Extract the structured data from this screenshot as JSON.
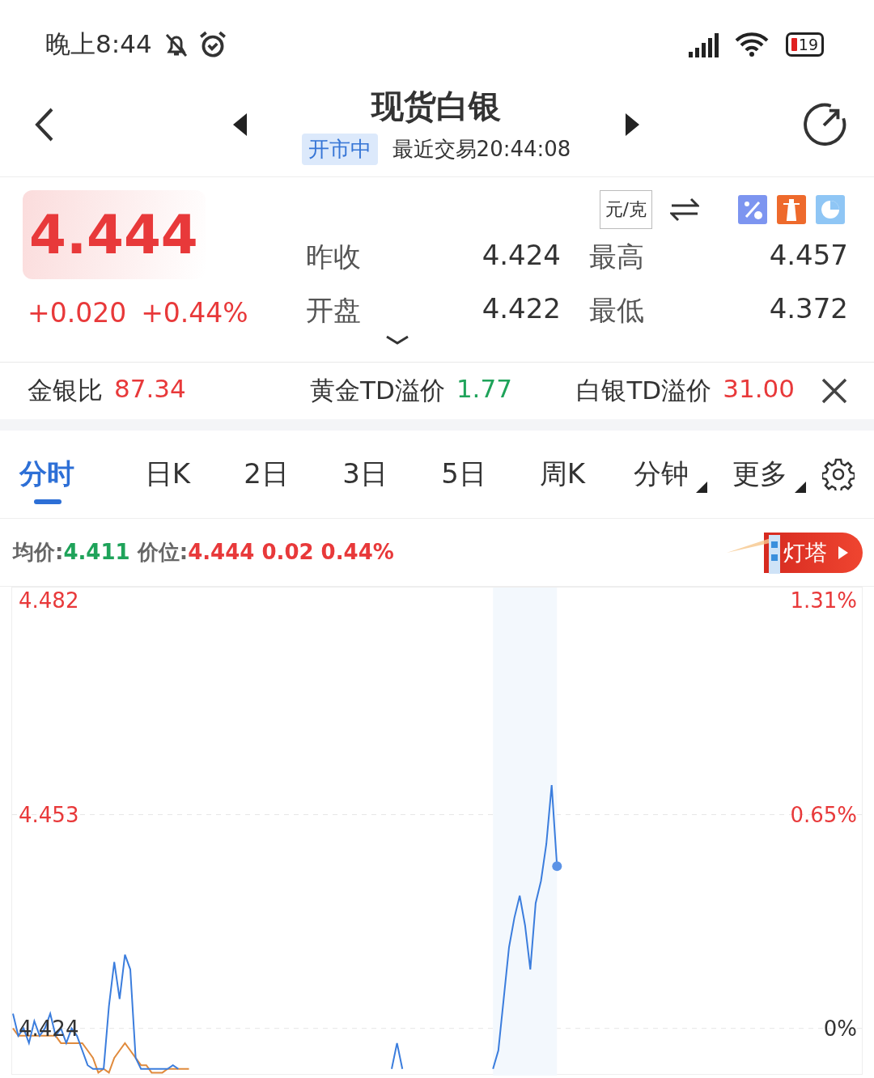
{
  "status_bar": {
    "time": "晚上8:44",
    "battery": "19"
  },
  "header": {
    "title": "现货白银",
    "status_badge": "开市中",
    "last_trade": "最近交易20:44:08"
  },
  "quote": {
    "price": "4.444",
    "change": "+0.020",
    "change_pct": "+0.44%",
    "unit": "元/克",
    "stats": [
      {
        "label": "昨收",
        "value": "4.424"
      },
      {
        "label": "最高",
        "value": "4.457"
      },
      {
        "label": "开盘",
        "value": "4.422"
      },
      {
        "label": "最低",
        "value": "4.372"
      }
    ]
  },
  "ratios": [
    {
      "label": "金银比",
      "value": "87.34",
      "color": "#e8393a"
    },
    {
      "label": "黄金TD溢价",
      "value": "1.77",
      "color": "#1fa35a"
    },
    {
      "label": "白银TD溢价",
      "value": "31.00",
      "color": "#e8393a"
    }
  ],
  "tabs": [
    {
      "label": "分时",
      "selected": true,
      "menu": false
    },
    {
      "label": "日K",
      "selected": false,
      "menu": false
    },
    {
      "label": "2日",
      "selected": false,
      "menu": false
    },
    {
      "label": "3日",
      "selected": false,
      "menu": false
    },
    {
      "label": "5日",
      "selected": false,
      "menu": false
    },
    {
      "label": "周K",
      "selected": false,
      "menu": false
    },
    {
      "label": "分钟",
      "selected": false,
      "menu": true
    },
    {
      "label": "更多",
      "selected": false,
      "menu": true
    }
  ],
  "legend": {
    "avg_label": "均价:",
    "avg": "4.411",
    "price_label": "价位:",
    "price": "4.444",
    "change": "0.02",
    "change_pct": "0.44%",
    "badge": "灯塔"
  },
  "chart": {
    "pct_labels": [
      "1.31%",
      "0.65%",
      "0%"
    ],
    "chart_data": {
      "type": "line",
      "ylim": [
        4.4176,
        4.4838
      ],
      "yticks": [
        4.482,
        4.453,
        4.424
      ],
      "series": [
        {
          "color": "#3b7ddd",
          "values": [
            4.426,
            4.423,
            4.424,
            4.422,
            4.425,
            4.423,
            4.424,
            4.426,
            4.423,
            4.424,
            4.422,
            4.424,
            4.423,
            4.421,
            4.419,
            4.4185,
            4.4185,
            4.4185,
            4.427,
            4.433,
            4.428,
            4.434,
            4.432,
            4.42,
            4.4185,
            4.4185,
            4.4185,
            4.4185,
            4.4185,
            4.4185,
            4.419,
            4.4185,
            null,
            null,
            null,
            null,
            null,
            null,
            null,
            null,
            null,
            null,
            null,
            null,
            null,
            null,
            null,
            null,
            null,
            null,
            null,
            null,
            null,
            null,
            null,
            null,
            null,
            null,
            null,
            null,
            null,
            null,
            null,
            null,
            null,
            null,
            null,
            null,
            null,
            null,
            null,
            4.4185,
            4.422,
            4.4185,
            null,
            null,
            null,
            null,
            null,
            null,
            null,
            null,
            null,
            null,
            null,
            null,
            null,
            null,
            null,
            null,
            4.4185,
            4.421,
            4.428,
            4.435,
            4.439,
            4.442,
            4.438,
            4.432,
            4.441,
            4.444,
            4.449,
            4.457,
            4.446,
            null,
            null,
            null,
            null,
            null,
            null,
            null,
            null,
            null,
            null,
            null,
            null,
            null,
            null,
            null,
            null,
            null,
            null,
            null,
            null,
            null,
            null,
            null,
            null,
            null,
            null,
            null,
            null,
            null,
            null,
            null,
            null,
            null,
            null,
            null,
            null,
            null,
            null,
            null,
            null,
            null,
            null,
            null,
            null,
            null,
            null,
            null,
            null,
            null,
            null,
            null,
            null,
            null,
            null
          ]
        },
        {
          "color": "#e08a3c",
          "values": [
            4.424,
            4.423,
            4.423,
            4.423,
            4.423,
            4.423,
            4.423,
            4.423,
            4.423,
            4.422,
            4.422,
            4.422,
            4.422,
            4.422,
            4.421,
            4.42,
            4.418,
            4.4185,
            4.418,
            4.42,
            4.421,
            4.422,
            4.421,
            4.42,
            4.419,
            4.419,
            4.418,
            4.418,
            4.418,
            4.4185,
            4.4185,
            4.4185,
            4.4185,
            4.4185,
            null,
            null,
            null,
            null,
            null,
            null,
            null,
            null,
            null,
            null,
            null,
            null,
            null,
            null,
            null,
            null,
            null,
            null,
            null,
            null,
            null,
            null,
            null,
            null,
            null,
            null,
            null,
            null,
            null,
            null,
            null,
            null,
            null,
            null,
            null,
            null,
            null,
            null,
            null,
            null,
            null,
            null,
            null,
            null,
            null,
            null,
            null,
            null,
            null,
            null,
            null,
            null,
            null,
            null,
            null,
            null,
            null,
            null,
            null,
            null,
            null,
            null,
            null,
            null,
            null,
            null,
            null,
            null,
            null,
            null,
            null,
            null,
            null,
            null,
            null,
            null,
            null,
            null,
            null,
            null,
            null,
            null,
            null,
            null,
            null,
            null,
            null,
            null,
            null,
            null,
            null,
            null,
            null,
            null,
            null,
            null,
            null,
            null,
            null,
            null,
            null,
            null,
            null,
            null,
            null,
            null,
            null,
            null,
            null,
            null,
            null,
            null,
            null,
            null,
            null,
            null,
            null,
            null,
            null,
            null,
            null,
            null,
            null,
            null,
            null,
            null
          ]
        }
      ]
    }
  }
}
